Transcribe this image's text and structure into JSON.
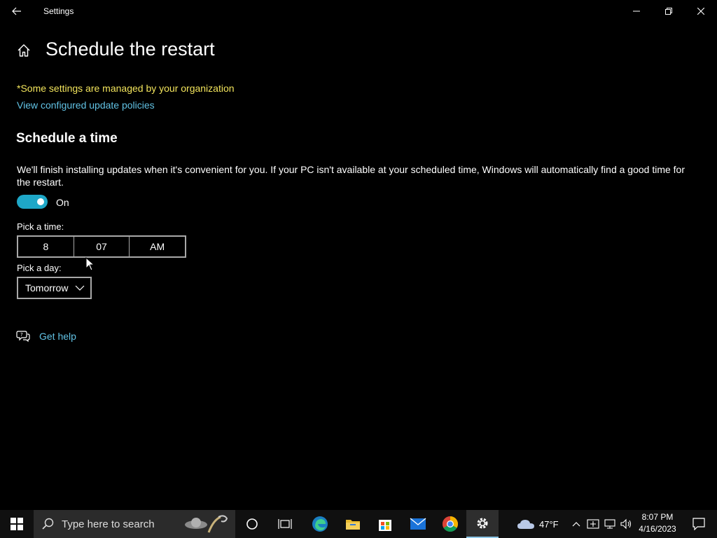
{
  "window": {
    "title": "Settings"
  },
  "header": {
    "page_title": "Schedule the restart"
  },
  "notices": {
    "managed": "*Some settings are managed by your organization",
    "policy_link": "View configured update policies"
  },
  "section": {
    "title": "Schedule a time",
    "description": "We'll finish installing updates when it's convenient for you. If your PC isn't available at your scheduled time, Windows will automatically find a good time for the restart.",
    "toggle_state": "On"
  },
  "time_picker": {
    "label": "Pick a time:",
    "hour": "8",
    "minute": "07",
    "period": "AM"
  },
  "day_picker": {
    "label": "Pick a day:",
    "selected": "Tomorrow"
  },
  "help": {
    "label": "Get help"
  },
  "taskbar": {
    "search_placeholder": "Type here to search",
    "apps": [
      "cortana-icon",
      "task-view-icon",
      "edge-icon",
      "file-explorer-icon",
      "store-icon",
      "mail-icon",
      "chrome-icon",
      "settings-icon"
    ],
    "weather_temp": "47°F",
    "time": "8:07 PM",
    "date": "4/16/2023"
  },
  "colors": {
    "accent": "#1ea7c7",
    "link": "#61c1e3",
    "warning": "#f2e45c",
    "background": "#000000"
  }
}
